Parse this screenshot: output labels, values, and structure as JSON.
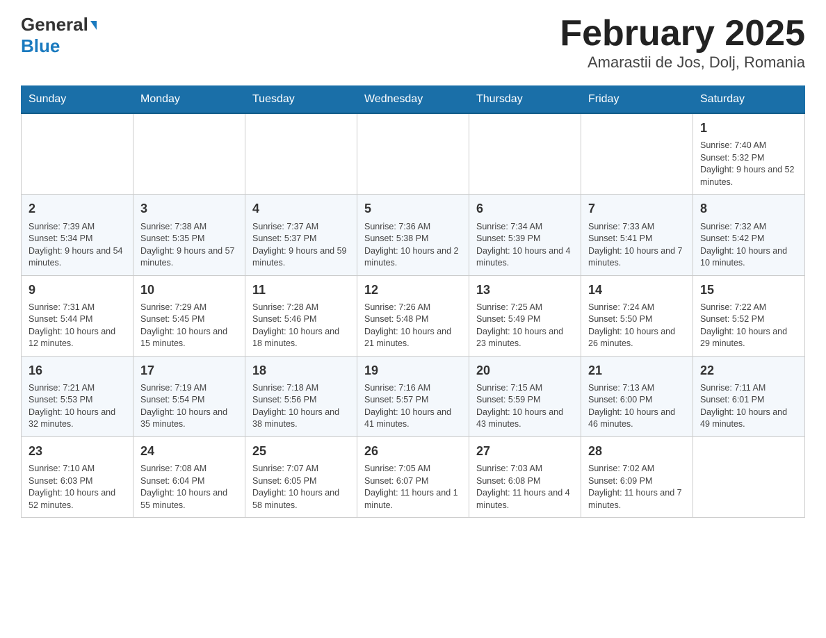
{
  "header": {
    "logo_general": "General",
    "logo_blue": "Blue",
    "title": "February 2025",
    "subtitle": "Amarastii de Jos, Dolj, Romania"
  },
  "days_of_week": [
    "Sunday",
    "Monday",
    "Tuesday",
    "Wednesday",
    "Thursday",
    "Friday",
    "Saturday"
  ],
  "weeks": [
    [
      {
        "day": "",
        "info": ""
      },
      {
        "day": "",
        "info": ""
      },
      {
        "day": "",
        "info": ""
      },
      {
        "day": "",
        "info": ""
      },
      {
        "day": "",
        "info": ""
      },
      {
        "day": "",
        "info": ""
      },
      {
        "day": "1",
        "info": "Sunrise: 7:40 AM\nSunset: 5:32 PM\nDaylight: 9 hours and 52 minutes."
      }
    ],
    [
      {
        "day": "2",
        "info": "Sunrise: 7:39 AM\nSunset: 5:34 PM\nDaylight: 9 hours and 54 minutes."
      },
      {
        "day": "3",
        "info": "Sunrise: 7:38 AM\nSunset: 5:35 PM\nDaylight: 9 hours and 57 minutes."
      },
      {
        "day": "4",
        "info": "Sunrise: 7:37 AM\nSunset: 5:37 PM\nDaylight: 9 hours and 59 minutes."
      },
      {
        "day": "5",
        "info": "Sunrise: 7:36 AM\nSunset: 5:38 PM\nDaylight: 10 hours and 2 minutes."
      },
      {
        "day": "6",
        "info": "Sunrise: 7:34 AM\nSunset: 5:39 PM\nDaylight: 10 hours and 4 minutes."
      },
      {
        "day": "7",
        "info": "Sunrise: 7:33 AM\nSunset: 5:41 PM\nDaylight: 10 hours and 7 minutes."
      },
      {
        "day": "8",
        "info": "Sunrise: 7:32 AM\nSunset: 5:42 PM\nDaylight: 10 hours and 10 minutes."
      }
    ],
    [
      {
        "day": "9",
        "info": "Sunrise: 7:31 AM\nSunset: 5:44 PM\nDaylight: 10 hours and 12 minutes."
      },
      {
        "day": "10",
        "info": "Sunrise: 7:29 AM\nSunset: 5:45 PM\nDaylight: 10 hours and 15 minutes."
      },
      {
        "day": "11",
        "info": "Sunrise: 7:28 AM\nSunset: 5:46 PM\nDaylight: 10 hours and 18 minutes."
      },
      {
        "day": "12",
        "info": "Sunrise: 7:26 AM\nSunset: 5:48 PM\nDaylight: 10 hours and 21 minutes."
      },
      {
        "day": "13",
        "info": "Sunrise: 7:25 AM\nSunset: 5:49 PM\nDaylight: 10 hours and 23 minutes."
      },
      {
        "day": "14",
        "info": "Sunrise: 7:24 AM\nSunset: 5:50 PM\nDaylight: 10 hours and 26 minutes."
      },
      {
        "day": "15",
        "info": "Sunrise: 7:22 AM\nSunset: 5:52 PM\nDaylight: 10 hours and 29 minutes."
      }
    ],
    [
      {
        "day": "16",
        "info": "Sunrise: 7:21 AM\nSunset: 5:53 PM\nDaylight: 10 hours and 32 minutes."
      },
      {
        "day": "17",
        "info": "Sunrise: 7:19 AM\nSunset: 5:54 PM\nDaylight: 10 hours and 35 minutes."
      },
      {
        "day": "18",
        "info": "Sunrise: 7:18 AM\nSunset: 5:56 PM\nDaylight: 10 hours and 38 minutes."
      },
      {
        "day": "19",
        "info": "Sunrise: 7:16 AM\nSunset: 5:57 PM\nDaylight: 10 hours and 41 minutes."
      },
      {
        "day": "20",
        "info": "Sunrise: 7:15 AM\nSunset: 5:59 PM\nDaylight: 10 hours and 43 minutes."
      },
      {
        "day": "21",
        "info": "Sunrise: 7:13 AM\nSunset: 6:00 PM\nDaylight: 10 hours and 46 minutes."
      },
      {
        "day": "22",
        "info": "Sunrise: 7:11 AM\nSunset: 6:01 PM\nDaylight: 10 hours and 49 minutes."
      }
    ],
    [
      {
        "day": "23",
        "info": "Sunrise: 7:10 AM\nSunset: 6:03 PM\nDaylight: 10 hours and 52 minutes."
      },
      {
        "day": "24",
        "info": "Sunrise: 7:08 AM\nSunset: 6:04 PM\nDaylight: 10 hours and 55 minutes."
      },
      {
        "day": "25",
        "info": "Sunrise: 7:07 AM\nSunset: 6:05 PM\nDaylight: 10 hours and 58 minutes."
      },
      {
        "day": "26",
        "info": "Sunrise: 7:05 AM\nSunset: 6:07 PM\nDaylight: 11 hours and 1 minute."
      },
      {
        "day": "27",
        "info": "Sunrise: 7:03 AM\nSunset: 6:08 PM\nDaylight: 11 hours and 4 minutes."
      },
      {
        "day": "28",
        "info": "Sunrise: 7:02 AM\nSunset: 6:09 PM\nDaylight: 11 hours and 7 minutes."
      },
      {
        "day": "",
        "info": ""
      }
    ]
  ]
}
